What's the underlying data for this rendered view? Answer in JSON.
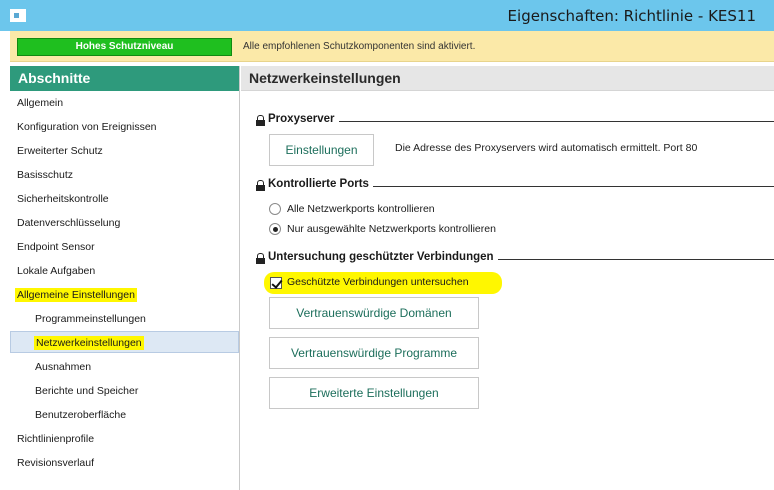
{
  "window": {
    "title": "Eigenschaften: Richtlinie - KES11"
  },
  "banner": {
    "level": "Hohes Schutzniveau",
    "message": "Alle empfohlenen Schutzkomponenten sind aktiviert.",
    "level_color": "#1fbf1f"
  },
  "sidebar": {
    "header": "Abschnitte",
    "items": [
      {
        "label": "Allgemein"
      },
      {
        "label": "Konfiguration von Ereignissen"
      },
      {
        "label": "Erweiterter Schutz"
      },
      {
        "label": "Basisschutz"
      },
      {
        "label": "Sicherheitskontrolle"
      },
      {
        "label": "Datenverschlüsselung"
      },
      {
        "label": "Endpoint Sensor"
      },
      {
        "label": "Lokale Aufgaben"
      },
      {
        "label": "Allgemeine Einstellungen"
      },
      {
        "label": "Programmeinstellungen"
      },
      {
        "label": "Netzwerkeinstellungen"
      },
      {
        "label": "Ausnahmen"
      },
      {
        "label": "Berichte und Speicher"
      },
      {
        "label": "Benutzeroberfläche"
      },
      {
        "label": "Richtlinienprofile"
      },
      {
        "label": "Revisionsverlauf"
      }
    ],
    "selected": "Netzwerkeinstellungen"
  },
  "content": {
    "title": "Netzwerkeinstellungen",
    "proxy": {
      "title": "Proxyserver",
      "button": "Einstellungen",
      "note": "Die Adresse des Proxyservers wird automatisch ermittelt. Port 80"
    },
    "ports": {
      "title": "Kontrollierte Ports",
      "option_all": "Alle Netzwerkports kontrollieren",
      "option_selected": "Nur ausgewählte Netzwerkports kontrollieren",
      "selected_option": "Nur ausgewählte Netzwerkports kontrollieren"
    },
    "secure": {
      "title": "Untersuchung geschützter Verbindungen",
      "checkbox_label": "Geschützte Verbindungen untersuchen",
      "checkbox_checked": true,
      "btn_domains": "Vertrauenswürdige Domänen",
      "btn_programs": "Vertrauenswürdige Programme",
      "btn_advanced": "Erweiterte Einstellungen"
    }
  },
  "colors": {
    "titlebar": "#6cc6ec",
    "sidebar_header": "#2e9a7c",
    "highlight": "#fff700",
    "banner": "#fbe9a8",
    "button_text": "#1c6e5b"
  },
  "icons": {
    "app": "window-icon",
    "lock": "lock-icon"
  }
}
